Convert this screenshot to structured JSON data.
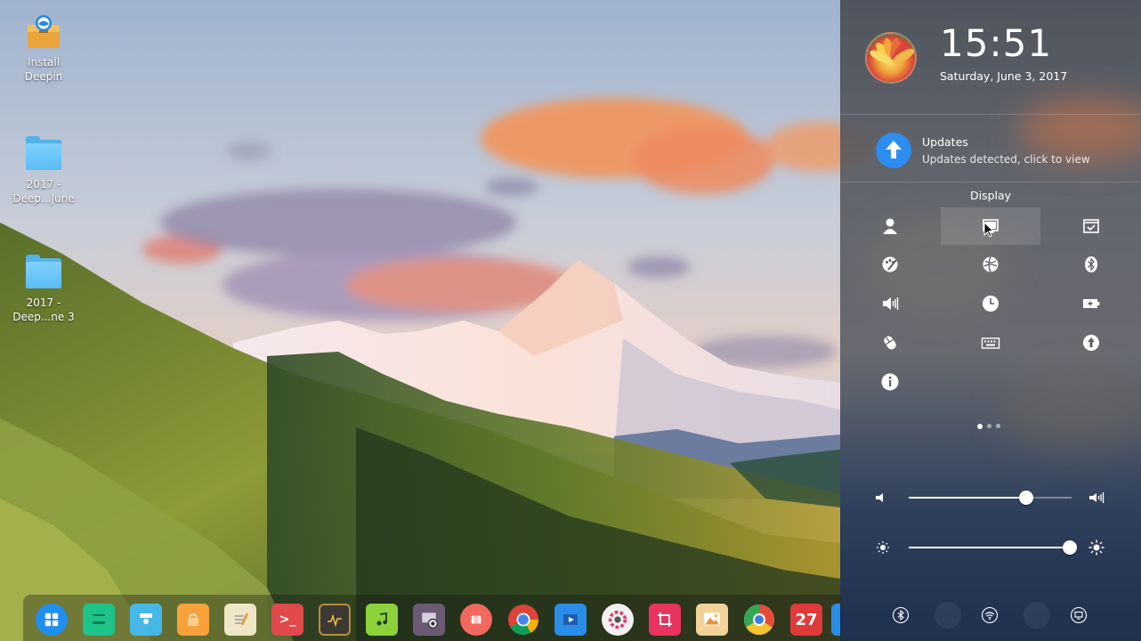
{
  "desktop": {
    "icons": [
      {
        "label": "Install\nDeepin",
        "icon": "install-deepin-icon"
      },
      {
        "label": "2017 -\nDeep...June",
        "icon": "folder-icon"
      },
      {
        "label": "2017 -\nDeep...ne 3",
        "icon": "folder-icon"
      }
    ]
  },
  "dock": {
    "apps": [
      {
        "name": "launcher",
        "icon": "launcher-icon",
        "color": "#1f8ff0"
      },
      {
        "name": "file-manager",
        "icon": "file-manager-icon",
        "color": "#1ec389"
      },
      {
        "name": "app-store",
        "icon": "app-store-icon",
        "color": "#45b8e8"
      },
      {
        "name": "shopping",
        "icon": "shopping-bag-icon",
        "color": "#f7a13a"
      },
      {
        "name": "text-editor",
        "icon": "notepad-icon",
        "color": "#efe6c8"
      },
      {
        "name": "terminal",
        "icon": "terminal-icon",
        "color": "#e04a4a"
      },
      {
        "name": "system-monitor",
        "icon": "monitor-icon",
        "color": "#3d3a34"
      },
      {
        "name": "music",
        "icon": "music-icon",
        "color": "#8cd23a"
      },
      {
        "name": "screenshot",
        "icon": "camera-icon",
        "color": "#6c5a74"
      },
      {
        "name": "screen-recorder",
        "icon": "recorder-icon",
        "color": "#f2685e"
      },
      {
        "name": "chrome",
        "icon": "chrome-icon",
        "color": "#e6e6e6"
      },
      {
        "name": "movie",
        "icon": "movie-icon",
        "color": "#2a8ee8"
      },
      {
        "name": "settings",
        "icon": "settings-icon",
        "color": "#f1f1f1"
      },
      {
        "name": "crop",
        "icon": "crop-icon",
        "color": "#e8345e"
      },
      {
        "name": "image-viewer",
        "icon": "image-viewer-icon",
        "color": "#f3d29a"
      },
      {
        "name": "browser",
        "icon": "browser-icon",
        "color": "#f4f4f4"
      },
      {
        "name": "calendar",
        "icon": "calendar-icon",
        "color": "#e03a3a",
        "text": "27"
      },
      {
        "name": "partial-app",
        "icon": "partial-app-icon",
        "color": "#2a8ee8"
      }
    ]
  },
  "panel": {
    "time": "15:51",
    "date": "Saturday, June 3, 2017",
    "updates": {
      "title": "Updates",
      "desc": "Updates detected, click to view"
    },
    "grid_title": "Display",
    "grid": [
      [
        "accounts-icon",
        "display-icon",
        "default-apps-icon"
      ],
      [
        "personalization-icon",
        "network-icon",
        "bluetooth-icon"
      ],
      [
        "sound-icon",
        "time-icon",
        "power-icon"
      ],
      [
        "mouse-icon",
        "keyboard-icon",
        "update-icon"
      ],
      [
        "info-icon",
        "",
        ""
      ]
    ],
    "highlighted_cell": "display-icon",
    "page": {
      "current": 1,
      "total": 3
    },
    "volume": 0.72,
    "brightness": 0.99,
    "quick": [
      "bluetooth-quick-icon",
      "blank-1",
      "wifi-quick-icon",
      "blank-2",
      "display-quick-icon"
    ]
  },
  "colors": {
    "accent": "#2d8df0"
  }
}
